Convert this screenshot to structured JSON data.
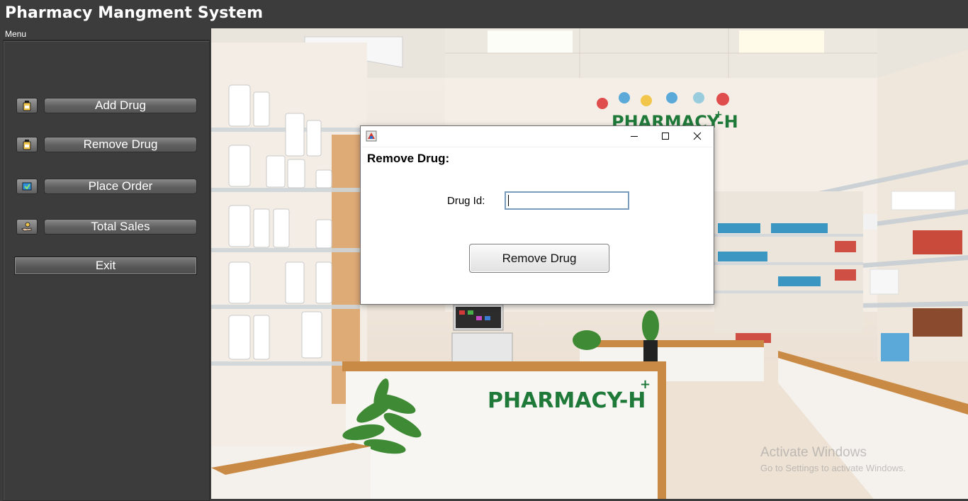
{
  "app": {
    "title": "Pharmacy Mangment System",
    "menu_label": "Menu"
  },
  "sidebar": {
    "items": [
      {
        "label": "Add Drug",
        "icon": "medicine-bottle-icon"
      },
      {
        "label": "Remove Drug",
        "icon": "medicine-bottle-icon"
      },
      {
        "label": "Place Order",
        "icon": "order-icon"
      },
      {
        "label": "Total Sales",
        "icon": "sales-hand-icon"
      }
    ],
    "exit_label": "Exit"
  },
  "background": {
    "sign_top": "PHARMACY-H",
    "sign_counter": "PHARMACY-H",
    "sign_plus": "+"
  },
  "dialog": {
    "icon": "java-app-icon",
    "heading": "Remove Drug:",
    "field_label": "Drug Id:",
    "field_value": "",
    "button_label": "Remove Drug",
    "controls": [
      "minimize-icon",
      "maximize-icon",
      "close-icon"
    ]
  },
  "watermark": {
    "line1": "Activate Windows",
    "line2": "Go to Settings to activate Windows."
  },
  "colors": {
    "chrome": "#3c3c3c",
    "sign_green": "#1f7a3a",
    "wood": "#c98a45"
  }
}
